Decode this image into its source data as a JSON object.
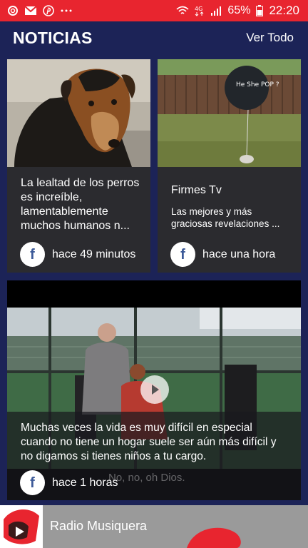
{
  "status_bar": {
    "battery": "65%",
    "time": "22:20",
    "left_icons": [
      "notification-swirl-icon",
      "gmail-icon",
      "pinterest-icon",
      "more-dots-icon"
    ],
    "right_icons": [
      "wifi-icon",
      "4g-icon",
      "signal-icon",
      "battery-icon"
    ],
    "color": "#e8252f"
  },
  "header": {
    "title": "NOTICIAS",
    "view_all": "Ver Todo"
  },
  "cards": [
    {
      "title": "La lealtad de los perros es increíble, lamentablemente muchos humanos n...",
      "subtitle": "",
      "source_icon": "facebook-icon",
      "time": "hace 49 minutos",
      "image": "dog-photo"
    },
    {
      "title": "Firmes Tv",
      "subtitle": "Las mejores y más graciosas revelaciones ...",
      "source_icon": "facebook-icon",
      "time": "hace una hora",
      "image": "backyard-balloon-photo",
      "balloon_text": "He She POP ?"
    }
  ],
  "video_card": {
    "title": "Muchas veces la vida es muy difícil en especial cuando no tiene un hogar suele ser aún más difícil y no digamos si tienes niños a tu cargo.",
    "time": "hace 1 horas",
    "caption": "No, no, oh Dios.",
    "source_icon": "facebook-icon",
    "play_icon": "play-icon"
  },
  "player": {
    "title": "Radio Musiquera",
    "icon": "radio-play-logo-icon"
  },
  "colors": {
    "background": "#1c2357",
    "card": "#2b2b2f",
    "facebook": "#3b5998",
    "accent": "#e8252f"
  }
}
